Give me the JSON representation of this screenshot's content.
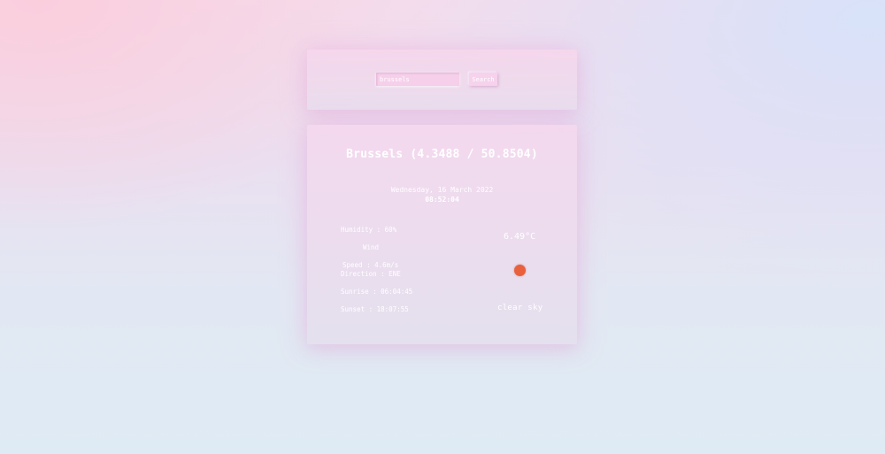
{
  "search": {
    "value": "brussels",
    "button_label": "Search"
  },
  "weather": {
    "location_title": "Brussels (4.3488 / 50.8504)",
    "date": "Wednesday, 16 March 2022",
    "time": "08:52:04",
    "humidity": "Humidity : 60%",
    "wind_heading": "Wind",
    "wind_speed": "Speed : 4.6m/s",
    "wind_direction": "Direction : ENE",
    "sunrise": "Sunrise : 06:04:45",
    "sunset": "Sunset : 18:07:55",
    "temperature": "6.49°C",
    "description": "clear sky",
    "icon": "sun-icon",
    "icon_color": "#e8603c"
  }
}
